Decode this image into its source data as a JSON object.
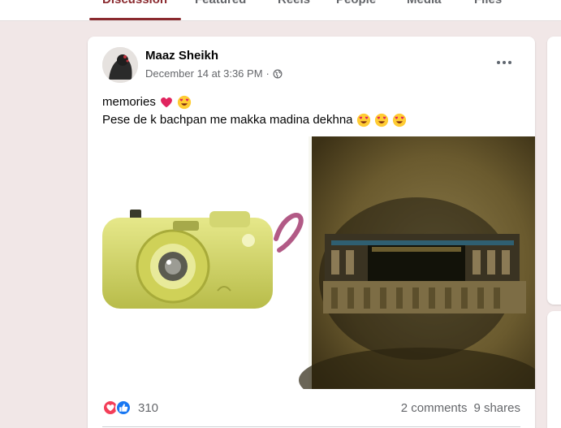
{
  "tabs": [
    {
      "label": "Discussion",
      "active": true
    },
    {
      "label": "Featured",
      "active": false
    },
    {
      "label": "Reels",
      "active": false
    },
    {
      "label": "People",
      "active": false
    },
    {
      "label": "Media",
      "active": false
    },
    {
      "label": "Files",
      "active": false
    }
  ],
  "colors": {
    "accent": "#8a2a2f",
    "page_bg": "#f1e7e7",
    "love": "#f33e58",
    "like": "#1877f2"
  },
  "post": {
    "author": "Maaz Sheikh",
    "timestamp": "December 14 at 3:36 PM",
    "separator": "·",
    "audience_icon": "globe-icon",
    "text_line1": "memories",
    "text_line2": "Pese de k bachpan me makka madina dekhna",
    "reaction_count": "310",
    "comments": "2 comments",
    "shares": "9 shares"
  }
}
